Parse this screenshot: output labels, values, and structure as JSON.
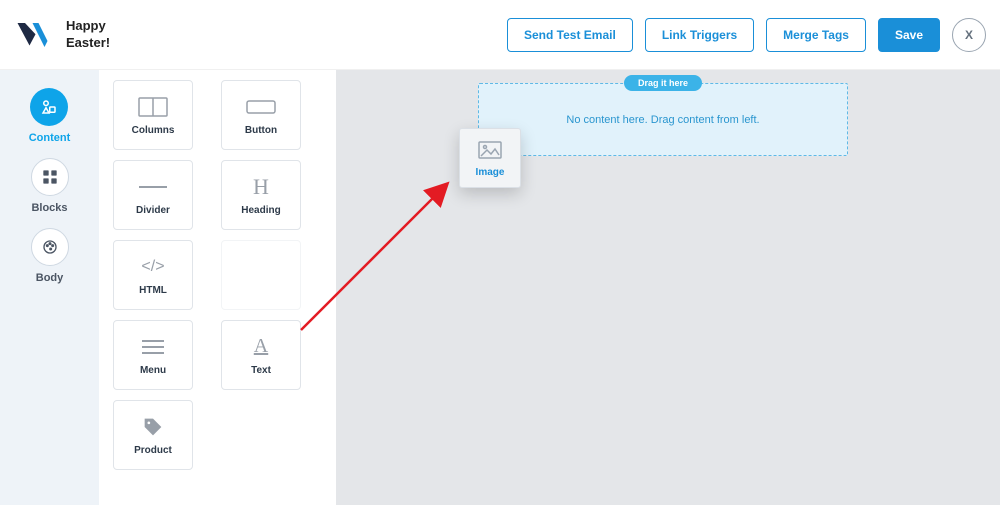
{
  "header": {
    "title": "Happy\nEaster!",
    "buttons": {
      "send_test": "Send Test Email",
      "link_triggers": "Link Triggers",
      "merge_tags": "Merge Tags",
      "save": "Save",
      "close": "X"
    }
  },
  "rail": {
    "content": "Content",
    "blocks": "Blocks",
    "body": "Body"
  },
  "components": {
    "columns": "Columns",
    "button": "Button",
    "divider": "Divider",
    "heading": "Heading",
    "html": "HTML",
    "menu": "Menu",
    "text": "Text",
    "product": "Product"
  },
  "canvas": {
    "drag_pill": "Drag it here",
    "drag_text": "No content here. Drag content from left."
  },
  "dragging": {
    "image_label": "Image"
  },
  "colors": {
    "accent": "#1a8fd8",
    "rail_active": "#0ea4e9",
    "arrow": "#e31b23"
  }
}
